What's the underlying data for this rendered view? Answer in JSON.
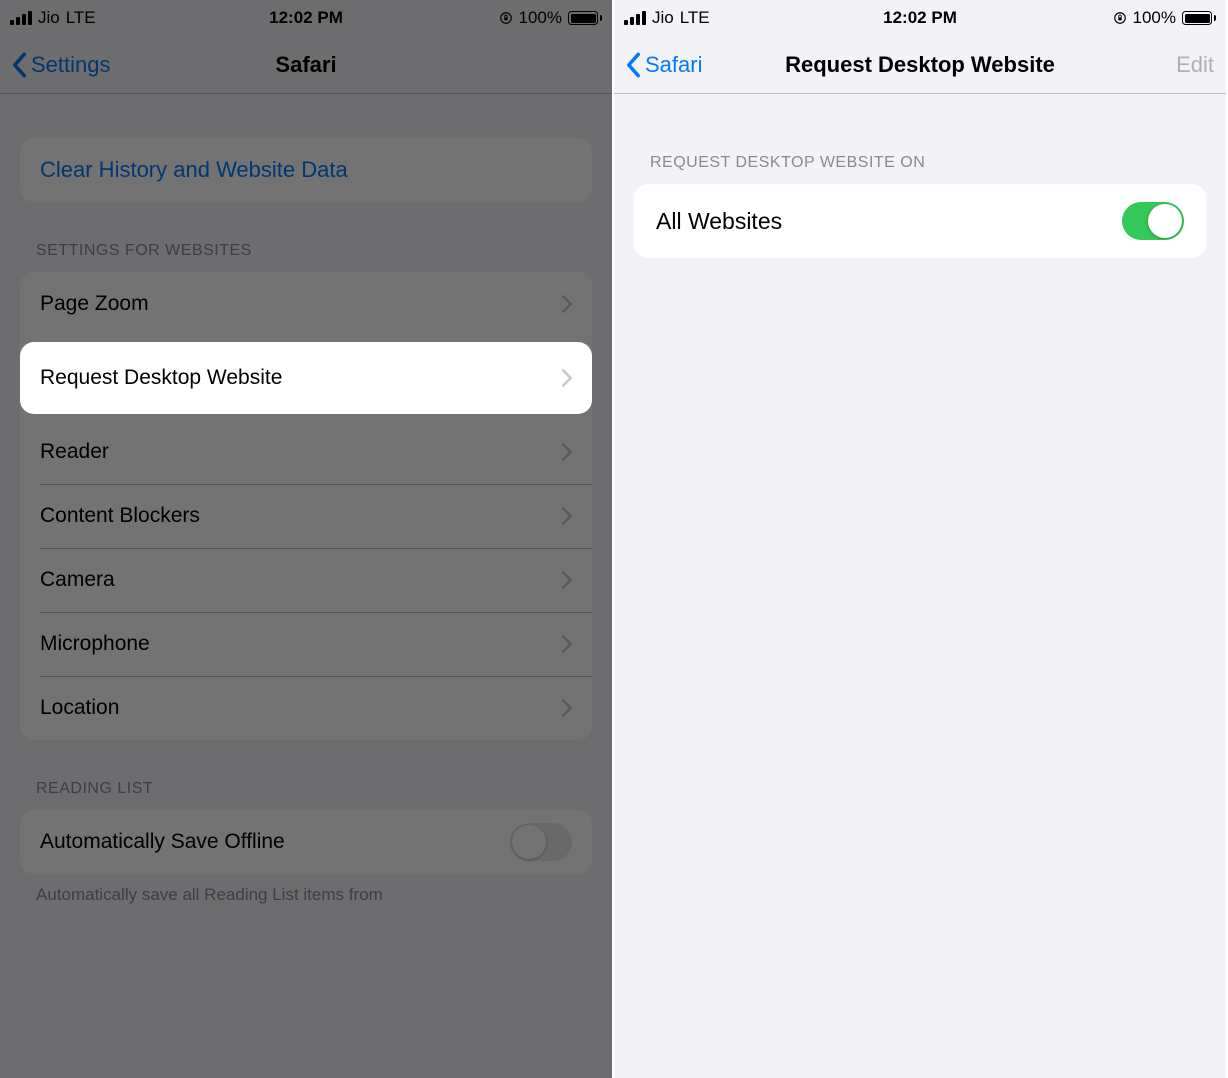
{
  "status": {
    "carrier": "Jio",
    "network": "LTE",
    "time": "12:02 PM",
    "battery_pct": "100%"
  },
  "left": {
    "back_label": "Settings",
    "title": "Safari",
    "clear_label": "Clear History and Website Data",
    "section_websites_header": "SETTINGS FOR WEBSITES",
    "items": {
      "page_zoom": "Page Zoom",
      "request_desktop": "Request Desktop Website",
      "reader": "Reader",
      "content_blockers": "Content Blockers",
      "camera": "Camera",
      "microphone": "Microphone",
      "location": "Location"
    },
    "section_reading_header": "READING LIST",
    "auto_save_label": "Automatically Save Offline",
    "auto_save_footer": "Automatically save all Reading List items from"
  },
  "right": {
    "back_label": "Safari",
    "title": "Request Desktop Website",
    "edit_label": "Edit",
    "section_header": "REQUEST DESKTOP WEBSITE ON",
    "all_websites_label": "All Websites"
  }
}
